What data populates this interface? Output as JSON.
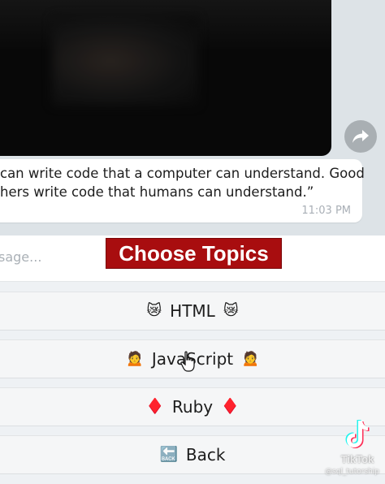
{
  "chat": {
    "quote_line1": "can write code that a computer can understand. Good",
    "quote_line2": "hers write code that humans can understand.”",
    "time": "11:03 PM"
  },
  "input": {
    "placeholder": "sage..."
  },
  "banner": {
    "title": "Choose Topics"
  },
  "keyboard": {
    "buttons": [
      {
        "label": "HTML",
        "emoji": "😿"
      },
      {
        "label": "JavaScript",
        "emoji": "🙍"
      },
      {
        "label": "Ruby",
        "emoji": "♦️"
      },
      {
        "label": "Back",
        "emoji": "🔙"
      }
    ]
  },
  "watermark": {
    "brand": "TikTok",
    "handle": "@sql_tutorship"
  },
  "colors": {
    "banner": "#a80d0f",
    "bubble": "#ffffff",
    "ruby": "#e0182d"
  },
  "icons": {
    "share": "share-arrow-icon",
    "cursor": "hand-pointer-icon",
    "logo": "tiktok-logo-icon"
  }
}
